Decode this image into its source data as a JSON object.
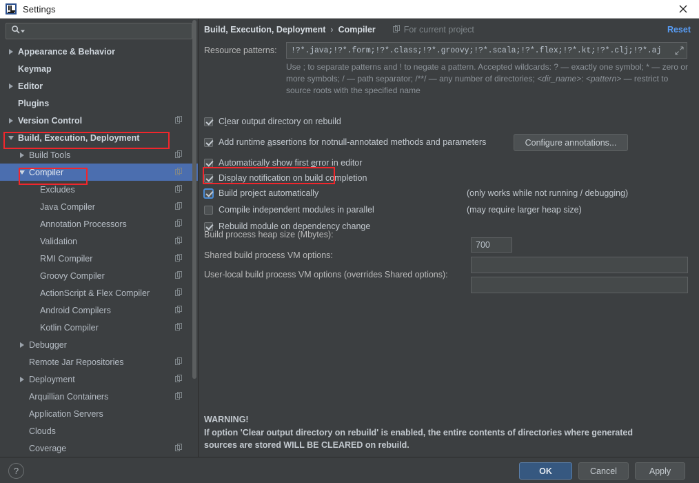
{
  "window": {
    "title": "Settings",
    "logo_icon": "intellij-idea-icon",
    "close_icon": "close-icon"
  },
  "sidebar": {
    "search": {
      "placeholder": "",
      "value": "",
      "icon": "search-icon",
      "dropdown_icon": "chevron-down-icon"
    },
    "items": [
      {
        "label": "Appearance & Behavior",
        "indent": 0,
        "arrow": "right",
        "bold": true,
        "badge": false,
        "selected": false
      },
      {
        "label": "Keymap",
        "indent": 0,
        "arrow": "none",
        "bold": true,
        "badge": false,
        "selected": false
      },
      {
        "label": "Editor",
        "indent": 0,
        "arrow": "right",
        "bold": true,
        "badge": false,
        "selected": false
      },
      {
        "label": "Plugins",
        "indent": 0,
        "arrow": "none",
        "bold": true,
        "badge": false,
        "selected": false
      },
      {
        "label": "Version Control",
        "indent": 0,
        "arrow": "right",
        "bold": true,
        "badge": true,
        "selected": false
      },
      {
        "label": "Build, Execution, Deployment",
        "indent": 0,
        "arrow": "down",
        "bold": true,
        "badge": false,
        "selected": false
      },
      {
        "label": "Build Tools",
        "indent": 1,
        "arrow": "right",
        "bold": false,
        "badge": true,
        "selected": false
      },
      {
        "label": "Compiler",
        "indent": 1,
        "arrow": "down",
        "bold": false,
        "badge": true,
        "selected": true
      },
      {
        "label": "Excludes",
        "indent": 2,
        "arrow": "none",
        "bold": false,
        "badge": true,
        "selected": false
      },
      {
        "label": "Java Compiler",
        "indent": 2,
        "arrow": "none",
        "bold": false,
        "badge": true,
        "selected": false
      },
      {
        "label": "Annotation Processors",
        "indent": 2,
        "arrow": "none",
        "bold": false,
        "badge": true,
        "selected": false
      },
      {
        "label": "Validation",
        "indent": 2,
        "arrow": "none",
        "bold": false,
        "badge": true,
        "selected": false
      },
      {
        "label": "RMI Compiler",
        "indent": 2,
        "arrow": "none",
        "bold": false,
        "badge": true,
        "selected": false
      },
      {
        "label": "Groovy Compiler",
        "indent": 2,
        "arrow": "none",
        "bold": false,
        "badge": true,
        "selected": false
      },
      {
        "label": "ActionScript & Flex Compiler",
        "indent": 2,
        "arrow": "none",
        "bold": false,
        "badge": true,
        "selected": false
      },
      {
        "label": "Android Compilers",
        "indent": 2,
        "arrow": "none",
        "bold": false,
        "badge": true,
        "selected": false
      },
      {
        "label": "Kotlin Compiler",
        "indent": 2,
        "arrow": "none",
        "bold": false,
        "badge": true,
        "selected": false
      },
      {
        "label": "Debugger",
        "indent": 1,
        "arrow": "right",
        "bold": false,
        "badge": false,
        "selected": false
      },
      {
        "label": "Remote Jar Repositories",
        "indent": 1,
        "arrow": "none",
        "bold": false,
        "badge": true,
        "selected": false
      },
      {
        "label": "Deployment",
        "indent": 1,
        "arrow": "right",
        "bold": false,
        "badge": true,
        "selected": false
      },
      {
        "label": "Arquillian Containers",
        "indent": 1,
        "arrow": "none",
        "bold": false,
        "badge": true,
        "selected": false
      },
      {
        "label": "Application Servers",
        "indent": 1,
        "arrow": "none",
        "bold": false,
        "badge": false,
        "selected": false
      },
      {
        "label": "Clouds",
        "indent": 1,
        "arrow": "none",
        "bold": false,
        "badge": false,
        "selected": false
      },
      {
        "label": "Coverage",
        "indent": 1,
        "arrow": "none",
        "bold": false,
        "badge": true,
        "selected": false
      }
    ]
  },
  "header": {
    "crumb_parent": "Build, Execution, Deployment",
    "crumb_sep": "›",
    "crumb_current": "Compiler",
    "scope_label": "For current project",
    "scope_icon": "project-scope-icon",
    "reset_label": "Reset"
  },
  "resource_patterns": {
    "label": "Resource patterns:",
    "value": "!?*.java;!?*.form;!?*.class;!?*.groovy;!?*.scala;!?*.flex;!?*.kt;!?*.clj;!?*.aj",
    "expand_icon": "expand-icon",
    "help_part1": "Use ; to separate patterns and ! to negate a pattern. Accepted wildcards: ? — exactly one symbol; * — zero or more symbols; / — path separator; /**/ — any number of directories; ",
    "help_italic1": "<dir_name>",
    "help_part2": ": ",
    "help_italic2": "<pattern>",
    "help_part3": " — restrict to source roots with the specified name"
  },
  "checkboxes": [
    {
      "label_pre": "C",
      "mnemonic": "l",
      "label_post": "ear output directory on rebuild",
      "checked": true,
      "focused": false,
      "hint": ""
    },
    {
      "label_pre": "Add runtime ",
      "mnemonic": "a",
      "label_post": "ssertions for notnull-annotated methods and parameters",
      "checked": true,
      "focused": false,
      "hint": ""
    },
    {
      "label_pre": "Automatically show first ",
      "mnemonic": "e",
      "label_post": "rror in editor",
      "checked": true,
      "focused": false,
      "hint": ""
    },
    {
      "label_pre": "Display notification on build completion",
      "mnemonic": "",
      "label_post": "",
      "checked": true,
      "focused": false,
      "hint": ""
    },
    {
      "label_pre": "Build project automatically",
      "mnemonic": "",
      "label_post": "",
      "checked": true,
      "focused": true,
      "hint": "(only works while not running / debugging)"
    },
    {
      "label_pre": "Compile independent modules in parallel",
      "mnemonic": "",
      "label_post": "",
      "checked": false,
      "focused": false,
      "hint": "(may require larger heap size)"
    },
    {
      "label_pre": "Rebuild module on dependency change",
      "mnemonic": "",
      "label_post": "",
      "checked": true,
      "focused": false,
      "hint": ""
    }
  ],
  "configure_annotations_button": "Configure annotations...",
  "fields": [
    {
      "label": "Build process heap size (Mbytes):",
      "value": "700"
    },
    {
      "label": "Shared build process VM options:",
      "value": ""
    },
    {
      "label": "User-local build process VM options (overrides Shared options):",
      "value": ""
    }
  ],
  "warning": {
    "title": "WARNING!",
    "line1": "If option 'Clear output directory on rebuild' is enabled, the entire contents of directories where generated",
    "line2": "sources are stored WILL BE CLEARED on rebuild."
  },
  "footer": {
    "help_label": "?",
    "ok_label": "OK",
    "cancel_label": "Cancel",
    "apply_label": "Apply"
  },
  "annotations": {
    "accent_red": "#f1262c",
    "selection_blue": "#4b6eaf",
    "link_blue": "#589df6"
  }
}
